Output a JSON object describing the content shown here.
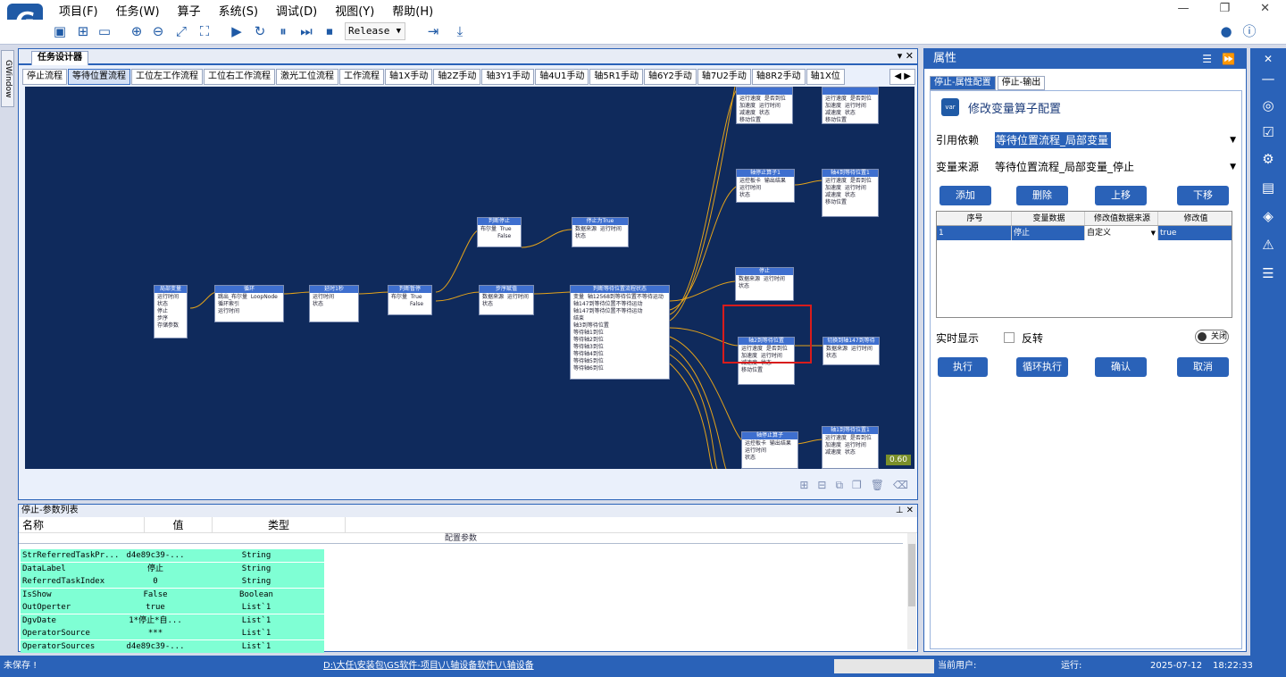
{
  "menu": [
    "项目(F)",
    "任务(W)",
    "算子",
    "系统(S)",
    "调试(D)",
    "视图(Y)",
    "帮助(H)"
  ],
  "toolbar": {
    "release": "Release"
  },
  "side_tab": "GWindow",
  "designer": {
    "title": "任务设计器",
    "flow_tabs": [
      "停止流程",
      "等待位置流程",
      "工位左工作流程",
      "工位右工作流程",
      "激光工位流程",
      "工作流程",
      "轴1X手动",
      "轴2Z手动",
      "轴3Y1手动",
      "轴4U1手动",
      "轴5R1手动",
      "轴6Y2手动",
      "轴7U2手动",
      "轴8R2手动",
      "轴1X位"
    ],
    "zoom": "0.60",
    "nodes": [
      {
        "t": "局部变量",
        "b": "运行时间\n状态\n停止\n步序\n存储参数"
      },
      {
        "t": "循环",
        "b": "跳出_布尔量  LoopNode\n循环索引\n运行时间"
      },
      {
        "t": "延时1秒",
        "b": "运行时间\n状态"
      },
      {
        "t": "判断暂停",
        "b": "布尔量  True\n           False"
      },
      {
        "t": "判断停止",
        "b": "布尔量  True\n          False"
      },
      {
        "t": "停止为True",
        "b": "数据来源  运行时间\n状态"
      },
      {
        "t": "步序赋值",
        "b": "数据来源  运行时间\n状态"
      },
      {
        "t": "判断等待位置流程状态",
        "b": "变量  轴12568到等待位置不等待运动\n轴147到等待位置不等待运动\n轴147到等待位置不等待运动\n结束\n轴3到等待位置\n等待轴1到位\n等待轴2到位\n等待轴3到位\n等待轴4到位\n等待轴5到位\n等待轴6到位"
      },
      {
        "t": "停止",
        "b": "数据来源  运行时间\n状态"
      },
      {
        "t": "轴停止算子1",
        "b": "运控板卡  输出结果\n运行时间\n状态"
      },
      {
        "t": "轴4到等待位置1",
        "b": "运行速度  是否到位\n加速度  运行时间\n减速度  状态\n移动位置"
      },
      {
        "t": "轴2到等待位置",
        "b": "运行速度  是否到位\n加速度  运行时间\n减速度  状态\n移动位置"
      },
      {
        "t": "切换到轴147到等待",
        "b": "数据来源  运行时间\n状态"
      },
      {
        "t": "轴停止算子",
        "b": "运控板卡  输出结果\n运行时间\n状态"
      },
      {
        "t": "轴1到等待位置1",
        "b": "运行速度  是否到位\n加速度  运行时间\n减速度  状态"
      },
      {
        "t": "",
        "b": "运行速度  是否到位\n加速度  运行时间\n减速度  状态\n移动位置"
      },
      {
        "t": "",
        "b": "运行速度  是否到位\n加速度  运行时间\n减速度  状态\n移动位置"
      }
    ]
  },
  "params": {
    "title": "停止-参数列表",
    "cols": [
      "名称",
      "值",
      "类型"
    ],
    "section": "配置参数",
    "rows": [
      [
        "StrReferredTaskPr...",
        "d4e89c39-...",
        "String"
      ],
      [
        "DataLabel",
        "停止",
        "String"
      ],
      [
        "ReferredTaskIndex",
        "0",
        "String"
      ],
      [
        "IsShow",
        "False",
        "Boolean"
      ],
      [
        "OutOperter",
        "true",
        "List`1"
      ],
      [
        "DgvDate",
        "1*停止*自...",
        "List`1"
      ],
      [
        "OperatorSource",
        "***",
        "List`1"
      ],
      [
        "OperatorSources",
        "d4e89c39-...",
        "List`1"
      ]
    ]
  },
  "props": {
    "title": "属性",
    "tabs": [
      "停止-属性配置",
      "停止-输出"
    ],
    "heading": "修改变量算子配置",
    "icon_text": "var",
    "ref_label": "引用依赖",
    "ref_value": "等待位置流程_局部变量",
    "src_label": "变量来源",
    "src_value": "等待位置流程_局部变量_停止",
    "buttons1": [
      "添加",
      "删除",
      "上移",
      "下移"
    ],
    "grid_cols": [
      "序号",
      "变量数据",
      "修改值数据来源",
      "修改值"
    ],
    "grid_row": [
      "1",
      "停止",
      "自定义",
      "true"
    ],
    "realtime_label": "实时显示",
    "reverse_label": "反转",
    "toggle_label": "关闭",
    "buttons2": [
      "执行",
      "循环执行",
      "确认",
      "取消"
    ]
  },
  "status": {
    "unsaved": "未保存 !",
    "path": "D:\\大任\\安装包\\GS软件-项目\\八轴设备软件\\八轴设备",
    "user": "当前用户:",
    "run": "运行:",
    "date": "2025-07-12",
    "time": "18:22:33"
  }
}
